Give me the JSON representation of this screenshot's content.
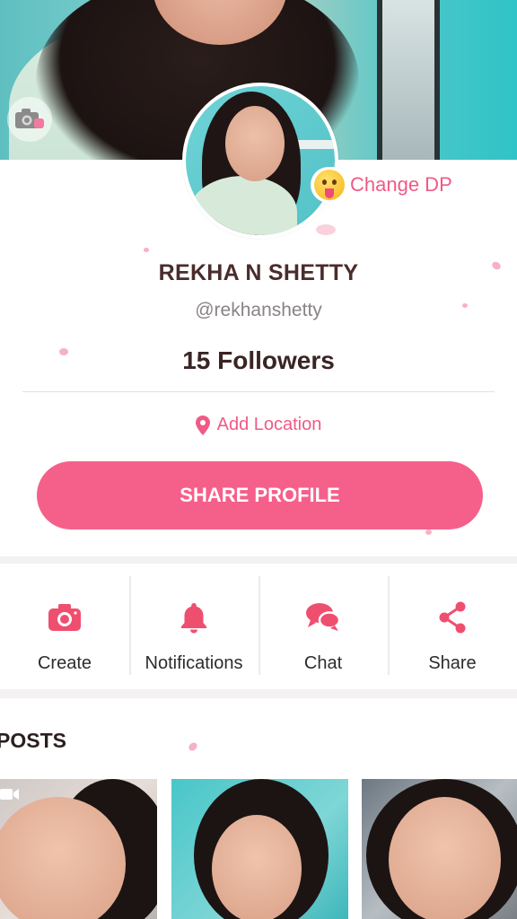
{
  "profile": {
    "change_dp_label": "Change DP",
    "name": "REKHA N SHETTY",
    "handle": "@rekhanshetty",
    "followers": "15 Followers",
    "location_label": "Add Location",
    "share_profile_label": "SHARE PROFILE"
  },
  "actions": [
    {
      "label": "Create",
      "icon": "camera-icon"
    },
    {
      "label": "Notifications",
      "icon": "bell-icon"
    },
    {
      "label": "Chat",
      "icon": "chat-icon"
    },
    {
      "label": "Share",
      "icon": "share-icon"
    }
  ],
  "posts": {
    "title": "POSTS",
    "count_visible": 3
  },
  "colors": {
    "accent": "#f5608a",
    "accent_text": "#ef5a86",
    "name_text": "#4a2c2c"
  }
}
